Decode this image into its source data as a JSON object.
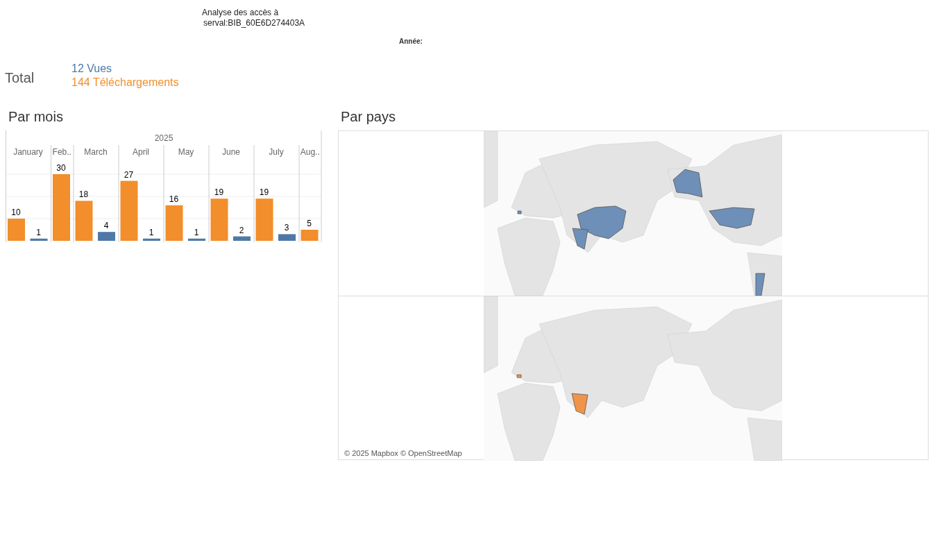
{
  "title_lines": [
    "Analyse des accès à",
    "serval:BIB_60E6D274403A"
  ],
  "filter_label": "Année:",
  "total": {
    "label": "Total",
    "views": "12 Vues",
    "downloads": "144 Téléchargements"
  },
  "by_month": {
    "title": "Par mois",
    "year": "2025",
    "chart_data": {
      "type": "bar",
      "categories": [
        "January",
        "Feb..",
        "March",
        "April",
        "May",
        "June",
        "July",
        "Aug.."
      ],
      "data_labels": true,
      "ref_lines": [
        {
          "axis": "y",
          "value": 10
        },
        {
          "axis": "y",
          "value": 20
        },
        {
          "axis": "y",
          "value": 30
        }
      ],
      "series": [
        {
          "color": "#f28e2b",
          "values": [
            10,
            30,
            18,
            27,
            16,
            19,
            19,
            5
          ]
        },
        {
          "color": "#4e79a7",
          "values": [
            1,
            null,
            4,
            1,
            1,
            2,
            3,
            null
          ]
        }
      ]
    }
  },
  "by_country": {
    "title": "Par pays",
    "attribution": "© 2025 Mapbox © OpenStreetMap"
  }
}
